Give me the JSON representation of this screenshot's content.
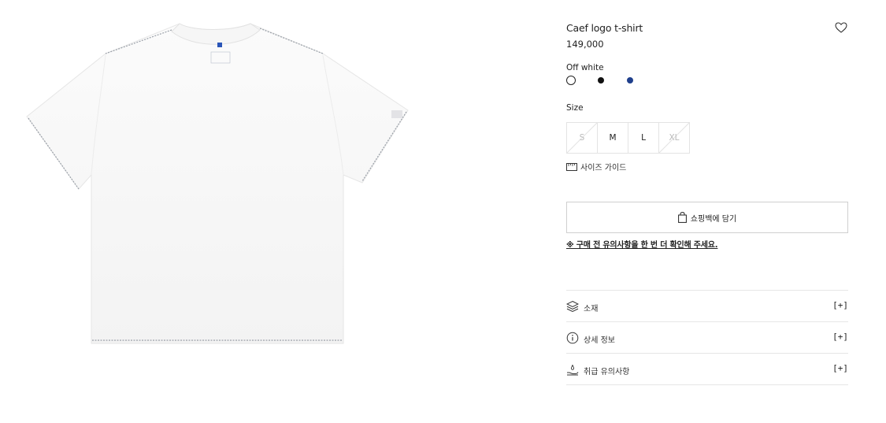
{
  "product": {
    "name": "Caef logo t-shirt",
    "price": "149,000",
    "image_icon": "white-tshirt-image"
  },
  "color": {
    "selected_name": "Off white",
    "swatches": [
      {
        "name": "off-white",
        "hex": "#ffffff",
        "selected": true
      },
      {
        "name": "black",
        "hex": "#111111",
        "selected": false
      },
      {
        "name": "navy-blue",
        "hex": "#1f3f8c",
        "selected": false
      }
    ]
  },
  "size": {
    "label": "Size",
    "options": [
      {
        "label": "S",
        "available": false
      },
      {
        "label": "M",
        "available": true
      },
      {
        "label": "L",
        "available": true
      },
      {
        "label": "XL",
        "available": false
      }
    ],
    "guide_label": "사이즈 가이드",
    "guide_icon": "ruler-icon"
  },
  "cart": {
    "button_label": "쇼핑백에 담기",
    "button_icon": "shopping-bag-icon",
    "notice": "※ 구매 전 유의사항을 한 번 더 확인해 주세요."
  },
  "accordion": [
    {
      "label": "소재",
      "icon": "layers-icon",
      "toggle": "[+]"
    },
    {
      "label": "상세 정보",
      "icon": "info-icon",
      "toggle": "[+]"
    },
    {
      "label": "취급 유의사항",
      "icon": "care-hand-icon",
      "toggle": "[+]"
    }
  ],
  "wishlist_icon": "heart-icon",
  "colors": {
    "text": "#222222",
    "border": "#e3e3e3",
    "navy": "#1f3f8c"
  }
}
